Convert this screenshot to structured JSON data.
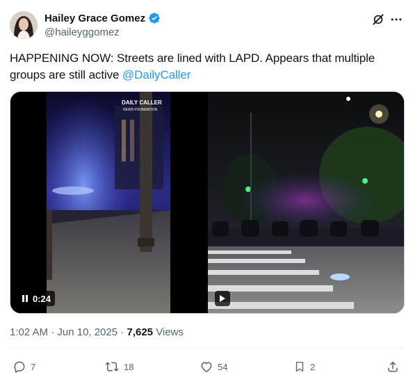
{
  "author": {
    "display_name": "Hailey Grace Gomez",
    "handle": "@haileyggomez",
    "verified": true
  },
  "tweet": {
    "text_before_mention": "HAPPENING NOW: Streets are lined with LAPD. Appears that multiple groups are still active ",
    "mention": "@DailyCaller"
  },
  "media": {
    "video1": {
      "time": "0:24",
      "state": "playing",
      "watermark_line1": "DAILY CALLER",
      "watermark_line2": "NEWS FOUNDATION"
    },
    "video2": {
      "state": "paused"
    }
  },
  "meta": {
    "time": "1:02 AM",
    "separator": " · ",
    "date": "Jun 10, 2025",
    "views_count": "7,625",
    "views_label": " Views"
  },
  "actions": {
    "replies": "7",
    "reposts": "18",
    "likes": "54",
    "bookmarks": "2"
  },
  "icons": [
    "verified-badge-icon",
    "grok-icon",
    "more-icon",
    "pause-icon",
    "play-icon",
    "reply-icon",
    "repost-icon",
    "like-icon",
    "bookmark-icon",
    "share-icon"
  ],
  "colors": {
    "accent": "#1d9bf0",
    "muted": "#536471",
    "text": "#0f1419"
  }
}
